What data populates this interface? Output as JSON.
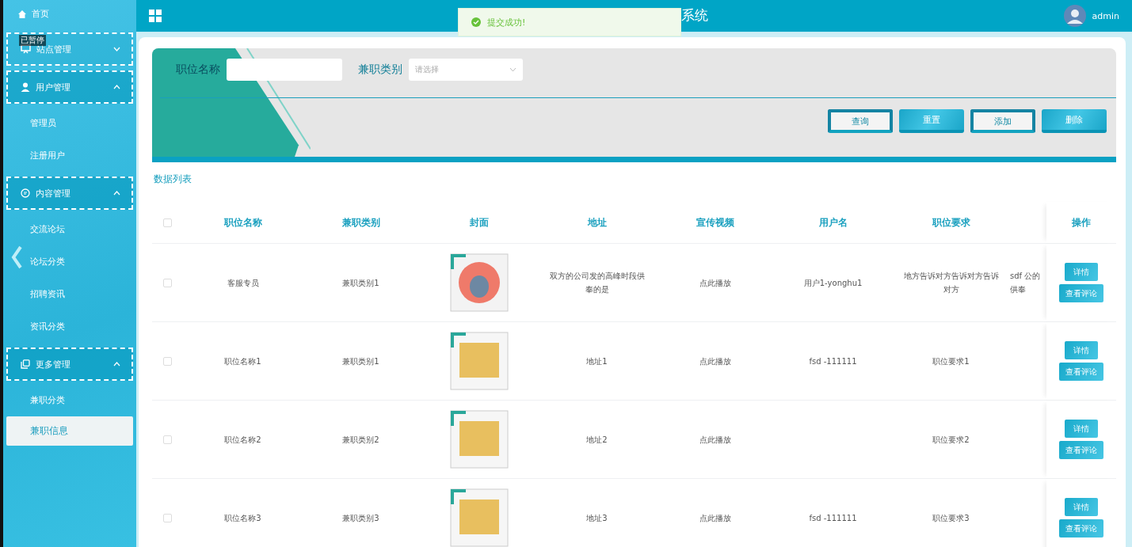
{
  "overlay_label": "已暂停",
  "sidebar": {
    "items": [
      {
        "kind": "link",
        "label": "首页"
      },
      {
        "kind": "group",
        "label": "站点管理",
        "expanded": false
      },
      {
        "kind": "group",
        "label": "用户管理",
        "expanded": true,
        "children": [
          {
            "label": "管理员",
            "selected": false
          },
          {
            "label": "注册用户",
            "selected": false
          }
        ]
      },
      {
        "kind": "group",
        "label": "内容管理",
        "expanded": true,
        "children": [
          {
            "label": "交流论坛",
            "selected": false
          },
          {
            "label": "论坛分类",
            "selected": false
          },
          {
            "label": "招聘资讯",
            "selected": false
          },
          {
            "label": "资讯分类",
            "selected": false
          }
        ]
      },
      {
        "kind": "group",
        "label": "更多管理",
        "expanded": true,
        "children": [
          {
            "label": "兼职分类",
            "selected": false
          },
          {
            "label": "兼职信息",
            "selected": true
          }
        ]
      }
    ]
  },
  "header": {
    "title": "系统",
    "user": "admin"
  },
  "toast": {
    "message": "提交成功!"
  },
  "search": {
    "fields": [
      {
        "kind": "input",
        "label": "职位名称"
      },
      {
        "kind": "select",
        "label": "兼职类别",
        "placeholder": "请选择"
      }
    ],
    "buttons": [
      {
        "label": "查询",
        "kind": "outline"
      },
      {
        "label": "重置",
        "kind": "filled"
      },
      {
        "label": "添加",
        "kind": "outline"
      },
      {
        "label": "删除",
        "kind": "filled"
      }
    ]
  },
  "table": {
    "title": "数据列表",
    "all_checked": false,
    "columns": [
      "职位名称",
      "兼职类别",
      "封面",
      "地址",
      "宣传视频",
      "用户名",
      "职位要求",
      "操作"
    ],
    "rows": [
      {
        "checked": false,
        "name": "客服专员",
        "category": "兼职类别1",
        "address": "双方的公司发的高峰时段供奉的是",
        "video": "点此播放",
        "username": "用户1-yonghu1",
        "requirement": "地方告诉对方告诉对方告诉对方",
        "column_8": "sdf 公的供奉",
        "actions": [
          "详情",
          "查看评论"
        ]
      },
      {
        "checked": false,
        "name": "职位名称1",
        "category": "兼职类别1",
        "address": "地址1",
        "video": "点此播放",
        "username": "fsd -111111",
        "requirement": "职位要求1",
        "actions": [
          "详情",
          "查看评论"
        ]
      },
      {
        "checked": false,
        "name": "职位名称2",
        "category": "兼职类别2",
        "address": "地址2",
        "video": "点此播放",
        "requirement": "职位要求2",
        "actions": [
          "详情",
          "查看评论"
        ]
      },
      {
        "checked": false,
        "name": "职位名称3",
        "category": "兼职类别3",
        "address": "地址3",
        "video": "点此播放",
        "username": "fsd -111111",
        "requirement": "职位要求3",
        "actions": [
          "详情",
          "查看评论"
        ]
      }
    ]
  }
}
